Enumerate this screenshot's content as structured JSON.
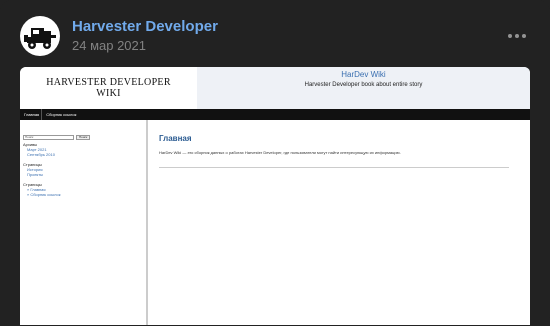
{
  "post": {
    "author": "Harvester Developer",
    "date": "24 мар 2021"
  },
  "wiki": {
    "logo_line1": "HARVESTER DEVELOPER",
    "logo_line2": "WIKI",
    "site_name": "HarDev Wiki",
    "tagline": "Harvester Developer book about entire story",
    "nav": [
      {
        "label": "Главная"
      },
      {
        "label": "Сборник ссылок"
      }
    ],
    "sidebar": {
      "search_placeholder": "Поиск",
      "search_button": "Поиск",
      "archives_head": "Архивы",
      "archives": [
        "Март 2021",
        "Сентябрь 2010"
      ],
      "pages_head": "Страницы",
      "pages": [
        "История",
        "Проекты"
      ],
      "pages2_head": "Страницы",
      "pages2": [
        "» Главная",
        "» Сборник ссылок"
      ]
    },
    "content": {
      "title": "Главная",
      "text": "HarDev Wiki — это сборник данных о работах Harvester Developer, где пользователи могут найти интересующую их информацию."
    }
  },
  "colors": {
    "background": "#222222",
    "author": "#71aaeb",
    "date": "#828282",
    "wiki_link": "#3a6fb0"
  },
  "icons": {
    "avatar": "harvester-machine-icon",
    "more": "three-dots-icon"
  }
}
